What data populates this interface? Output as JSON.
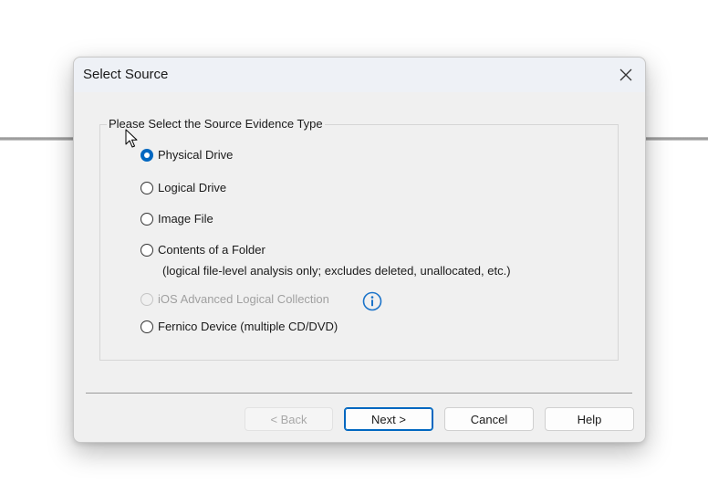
{
  "dialog": {
    "title": "Select Source",
    "close_icon": "close-icon",
    "group_label": "Please Select the Source Evidence Type",
    "options": [
      {
        "label": "Physical Drive",
        "selected": true,
        "enabled": true
      },
      {
        "label": "Logical Drive",
        "selected": false,
        "enabled": true
      },
      {
        "label": "Image File",
        "selected": false,
        "enabled": true
      },
      {
        "label": "Contents of a Folder",
        "selected": false,
        "enabled": true
      },
      {
        "label": "iOS Advanced Logical Collection",
        "selected": false,
        "enabled": false
      },
      {
        "label": "Fernico Device (multiple CD/DVD)",
        "selected": false,
        "enabled": true
      }
    ],
    "folder_note": "(logical file-level analysis only; excludes deleted, unallocated, etc.)",
    "info_icon": "info-icon",
    "buttons": {
      "back": "< Back",
      "next": "Next >",
      "cancel": "Cancel",
      "help": "Help"
    }
  },
  "colors": {
    "accent": "#0067c0",
    "info_icon": "#1a73c9",
    "disabled_text": "#a0a0a0"
  }
}
